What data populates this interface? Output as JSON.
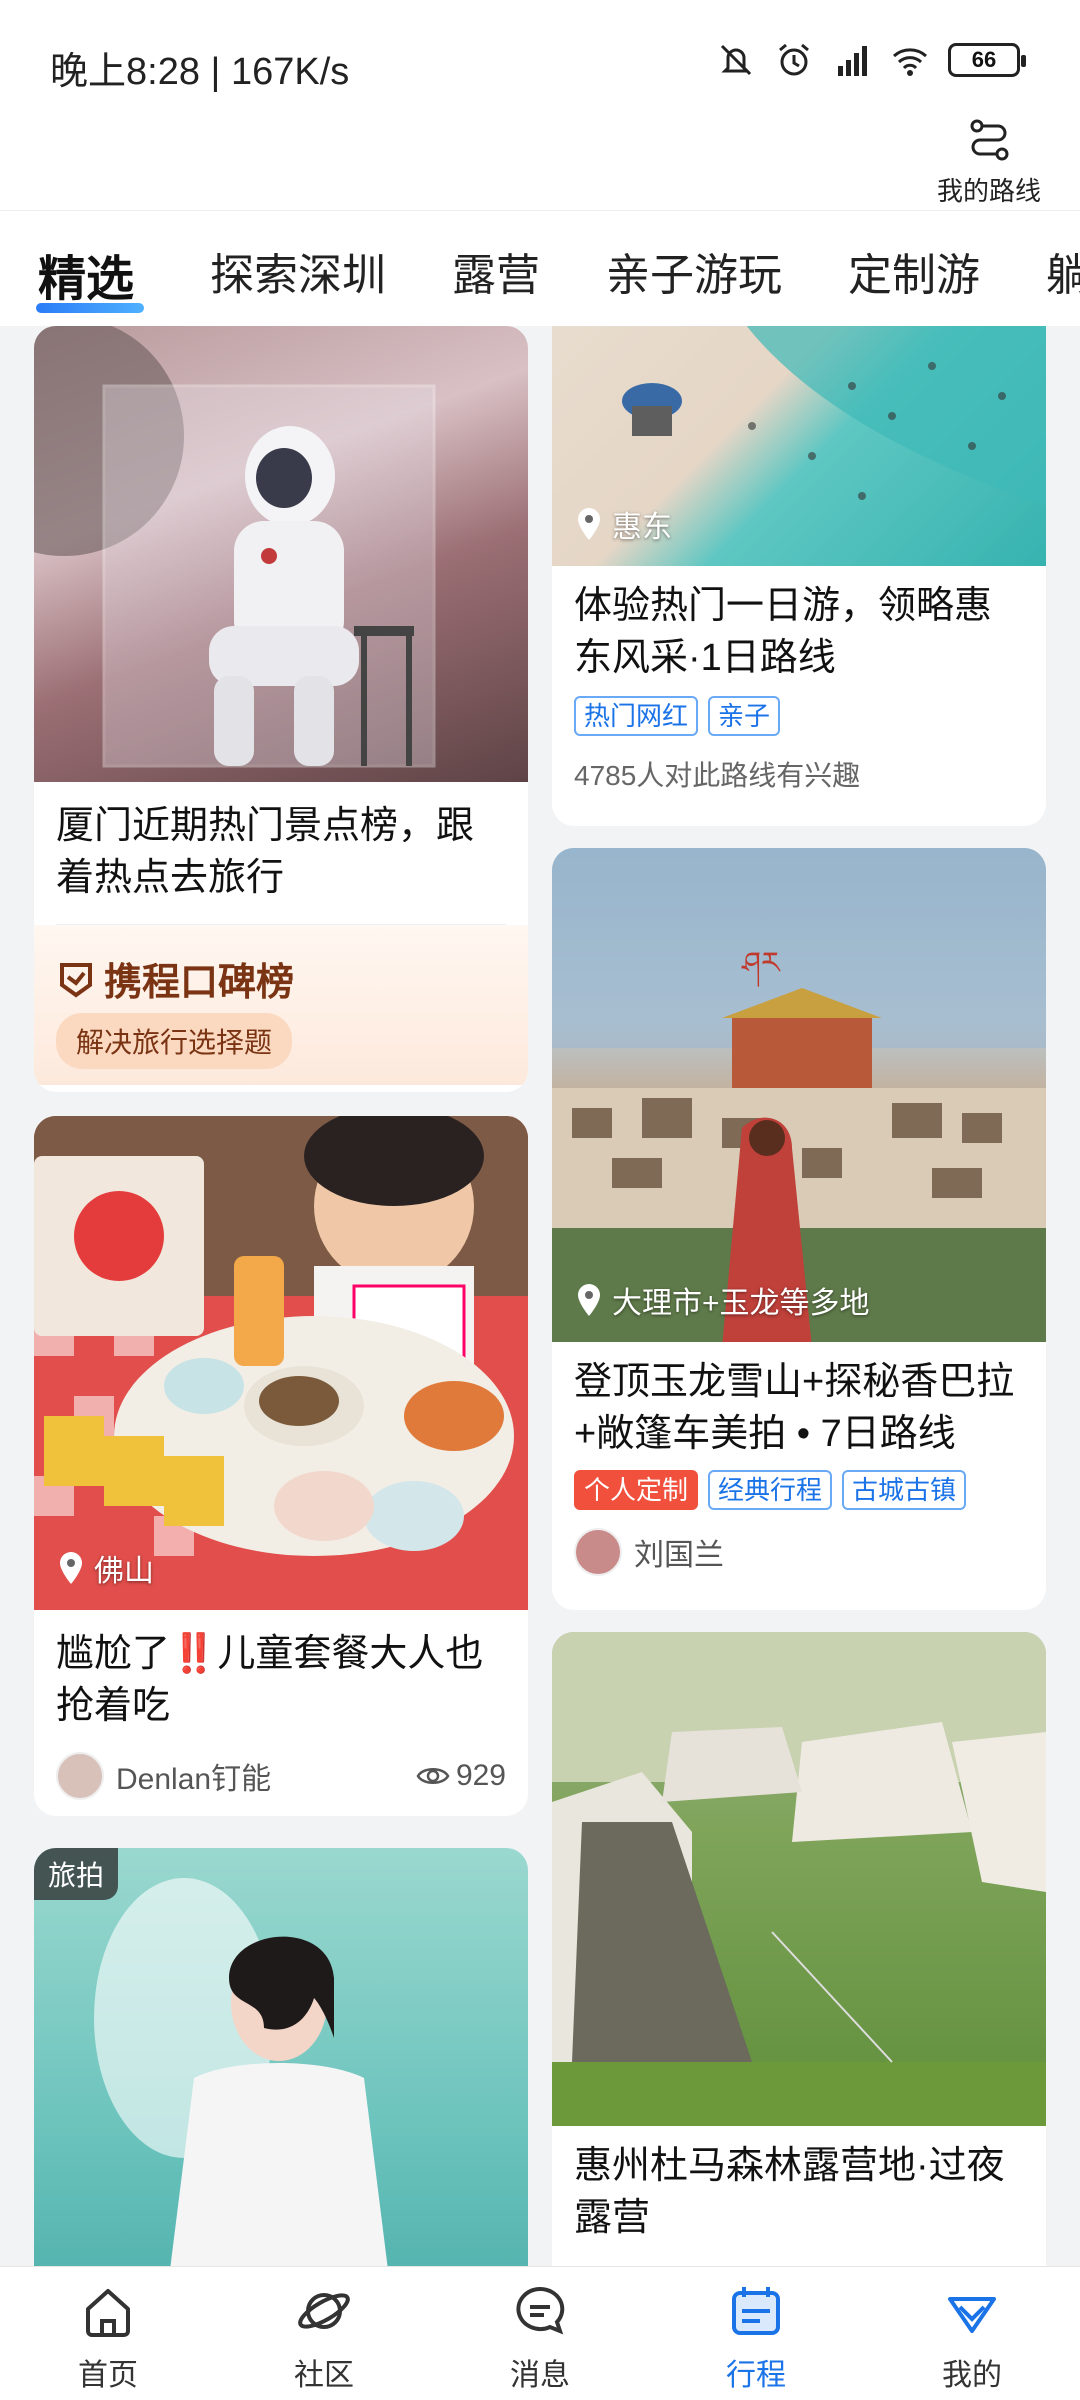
{
  "status_bar": {
    "time_speed": "晚上8:28 | 167K/s",
    "battery": "66"
  },
  "header": {
    "route_label": "我的路线"
  },
  "tabs": [
    {
      "label": "精选"
    },
    {
      "label": "探索深圳"
    },
    {
      "label": "露营"
    },
    {
      "label": "亲子游玩"
    },
    {
      "label": "定制游"
    },
    {
      "label": "躺"
    }
  ],
  "left_cards": [
    {
      "title": "厦门近期热门景点榜，跟着热点去旅行",
      "brand": "携程口碑榜",
      "brand_button": "解决旅行选择题"
    },
    {
      "location": "佛山",
      "title": "尴尬了‼️儿童套餐大人也抢着吃",
      "author": "Denlan钉能",
      "views": "929"
    },
    {
      "badge": "旅拍"
    }
  ],
  "right_cards": [
    {
      "location": "惠东",
      "title": "体验热门一日游，领略惠东风采·1日路线",
      "tags": [
        "热门网红",
        "亲子"
      ],
      "meta": "4785人对此路线有兴趣"
    },
    {
      "location": "大理市+玉龙等多地",
      "title": "登顶玉龙雪山+探秘香巴拉+敞篷车美拍 • 7日路线",
      "tags": [
        "个人定制",
        "经典行程",
        "古城古镇"
      ],
      "author": "刘国兰"
    },
    {
      "title": "惠州杜马森林露营地·过夜露营"
    }
  ],
  "bottom_nav": [
    {
      "label": "首页"
    },
    {
      "label": "社区"
    },
    {
      "label": "消息"
    },
    {
      "label": "行程"
    },
    {
      "label": "我的"
    }
  ],
  "colors": {
    "accent": "#1b73e8",
    "tag_red": "#f0503c"
  }
}
